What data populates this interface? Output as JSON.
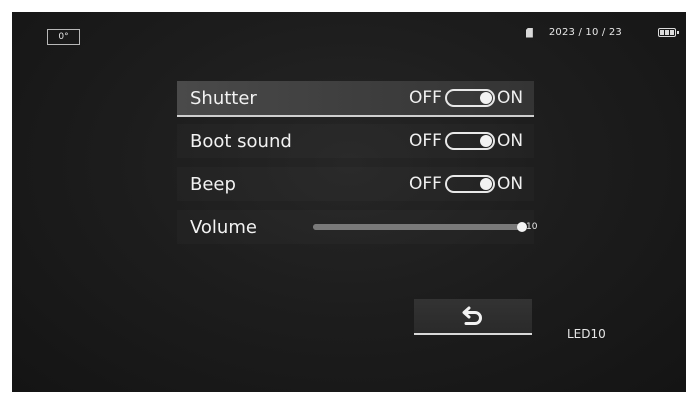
{
  "header": {
    "angle": "0°",
    "date": "2023 / 10 / 23",
    "sd_icon": "sd-card-icon",
    "battery_icon": "battery-full-icon"
  },
  "settings": {
    "shutter": {
      "label": "Shutter",
      "off": "OFF",
      "on": "ON",
      "state": "ON"
    },
    "boot_sound": {
      "label": "Boot sound",
      "off": "OFF",
      "on": "ON",
      "state": "ON"
    },
    "beep": {
      "label": "Beep",
      "off": "OFF",
      "on": "ON",
      "state": "ON"
    },
    "volume": {
      "label": "Volume",
      "value": "10",
      "max": 10
    }
  },
  "footer": {
    "back_icon": "back-arrow-icon",
    "mode_label": "LED10"
  },
  "colors": {
    "background": "#1d1d1d",
    "text": "#f2f2f2",
    "selected_row": "#444444"
  }
}
